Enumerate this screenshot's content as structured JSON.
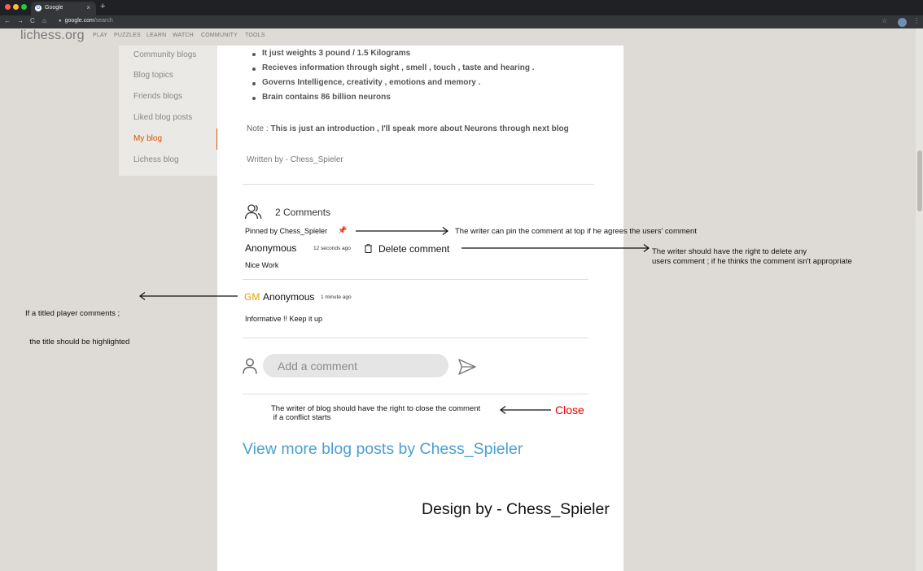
{
  "browser": {
    "tab_title": "Google",
    "tab_close": "×",
    "new_tab": "+",
    "url_host": "google.com",
    "url_path": "/search",
    "controls": [
      "←",
      "→",
      "C",
      "⌂"
    ]
  },
  "site": {
    "logo": "lichess.org",
    "nav": [
      "PLAY",
      "PUZZLES",
      "LEARN",
      "WATCH",
      "COMMUNITY",
      "TOOLS"
    ]
  },
  "sidebar": {
    "items": [
      {
        "label": "Community blogs"
      },
      {
        "label": "Blog topics"
      },
      {
        "label": "Friends blogs"
      },
      {
        "label": "Liked blog posts"
      },
      {
        "label": "My blog",
        "active": true
      },
      {
        "label": "Lichess blog"
      }
    ]
  },
  "article": {
    "bullets": [
      "It just weights 3 pound / 1.5 Kilograms",
      "Recieves information through sight , smell , touch , taste and hearing .",
      "Governs Intelligence, creativity , emotions and memory .",
      "Brain contains 86 billion neurons"
    ],
    "note_prefix": "Note : ",
    "note_text": "This is just an introduction , I'll speak more about Neurons through next blog",
    "written_by": "Written by - Chess_Spieler"
  },
  "comments": {
    "count_label": "2 Comments",
    "pinned_label": "Pinned by Chess_Spieler",
    "items": [
      {
        "author": "Anonymous",
        "time": "12 seconds ago",
        "text": "Nice Work",
        "delete_label": "Delete comment"
      },
      {
        "title": "GM",
        "author": "Anonymous",
        "time": "1 minute ago",
        "text": "Informative !! Keep it up"
      }
    ],
    "input_placeholder": "Add a comment",
    "close_note_line1": "The writer of blog should have the right to close the comment",
    "close_note_line2": " if a conflict starts",
    "close_label": "Close"
  },
  "links": {
    "view_more": "View more blog posts by Chess_Spieler"
  },
  "credit": "Design by - Chess_Spieler",
  "annotations": {
    "pin": "The writer can pin the comment at top if he agrees the users' comment",
    "delete_line1": "The writer should have the right to delete any",
    "delete_line2": "users comment ; if he thinks the comment isn't appropriate",
    "title_line1": "If a titled player comments ;",
    "title_line2": "  the title should be highlighted"
  },
  "colors": {
    "accent": "#d85000",
    "link": "#4a9fd2",
    "title_gm": "#e0a000",
    "close": "#e60000"
  }
}
